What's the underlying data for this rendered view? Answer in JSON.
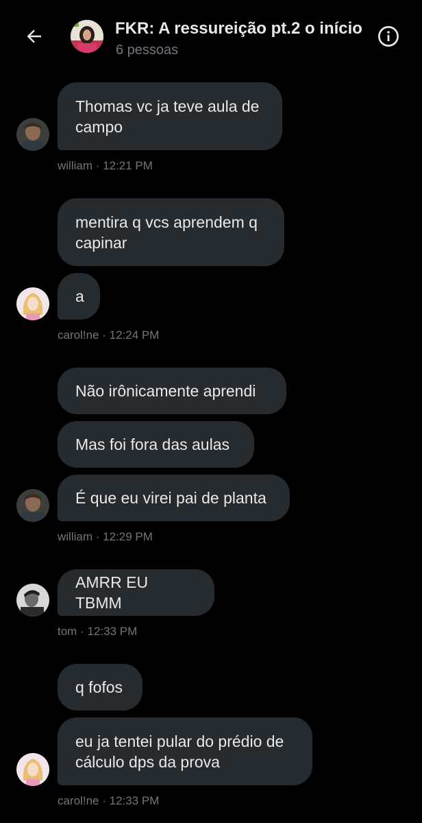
{
  "header": {
    "back_icon": "arrow-left-icon",
    "title": "FKR: A ressureição pt.2 o início",
    "subtitle": "6 pessoas",
    "info_icon": "info-circle-icon"
  },
  "messages": [
    {
      "text_lines": [
        "Thomas vc ja teve aula de",
        "campo"
      ]
    },
    {
      "text_lines": [
        "mentira q vcs aprendem q",
        "capinar"
      ]
    },
    {
      "text_lines": [
        "a"
      ]
    },
    {
      "text_lines": [
        "Não irônicamente aprendi"
      ]
    },
    {
      "text_lines": [
        "Mas foi fora das aulas"
      ]
    },
    {
      "text_lines": [
        "É que eu virei pai de planta"
      ]
    },
    {
      "text_lines": [
        "AMRR EU TBMM"
      ]
    },
    {
      "text_lines": [
        "q fofos"
      ]
    },
    {
      "text_lines": [
        "eu ja tentei pular do prédio de",
        "cálculo dps da prova"
      ]
    }
  ],
  "meta": [
    {
      "author": "william",
      "time": "12:21 PM"
    },
    {
      "author": "carol!ne",
      "time": "12:24 PM"
    },
    {
      "author": "william",
      "time": "12:29 PM"
    },
    {
      "author": "tom",
      "time": "12:33 PM"
    },
    {
      "author": "carol!ne",
      "time": "12:33 PM"
    }
  ],
  "separator": "·",
  "colors": {
    "background": "#000000",
    "bubble": "#262b30",
    "text": "#e7e9ea",
    "muted": "#71767b"
  }
}
